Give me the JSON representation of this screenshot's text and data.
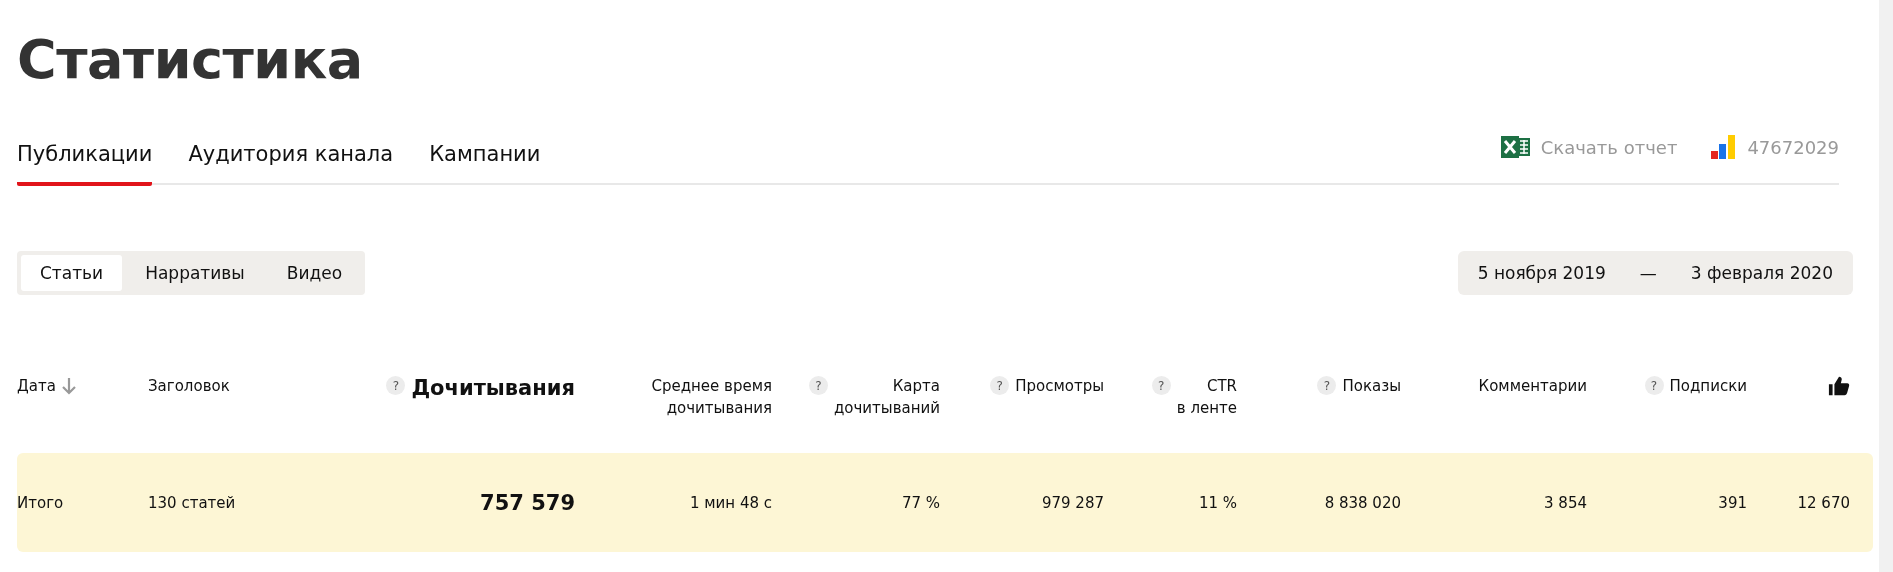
{
  "title": "Статистика",
  "tabs": [
    {
      "label": "Публикации",
      "selected": true
    },
    {
      "label": "Аудитория канала",
      "selected": false
    },
    {
      "label": "Кампании",
      "selected": false
    }
  ],
  "actions": [
    {
      "kind": "excel",
      "label": "Скачать отчет"
    },
    {
      "kind": "metrika",
      "label": "47672029"
    }
  ],
  "segments": [
    {
      "label": "Статьи",
      "selected": true
    },
    {
      "label": "Нарративы",
      "selected": false
    },
    {
      "label": "Видео",
      "selected": false
    }
  ],
  "date_range": {
    "from": "5 ноября 2019",
    "separator": "—",
    "to": "3 февраля 2020"
  },
  "table": {
    "columns": [
      {
        "label": "Дата",
        "sorted": true
      },
      {
        "label": "Заголовок"
      },
      {
        "label": "Дочитывания",
        "help": "?",
        "primary": true
      },
      {
        "label": "Среднее время\nдочитывания"
      },
      {
        "label": "Карта\nдочитываний",
        "help": "?"
      },
      {
        "label": "Просмотры",
        "help": "?"
      },
      {
        "label": "CTR\nв ленте",
        "help": "?"
      },
      {
        "label": "Показы",
        "help": "?"
      },
      {
        "label": "Комментарии"
      },
      {
        "label": "Подписки",
        "help": "?"
      },
      {
        "kind": "likes"
      }
    ],
    "rows": [
      {
        "kind": "total",
        "cells": [
          "Итого",
          "130 статей",
          "757 579",
          "1 мин 48 с",
          "77 %",
          "979 287",
          "11 %",
          "8 838 020",
          "3 854",
          "391",
          "12 670"
        ]
      }
    ]
  }
}
